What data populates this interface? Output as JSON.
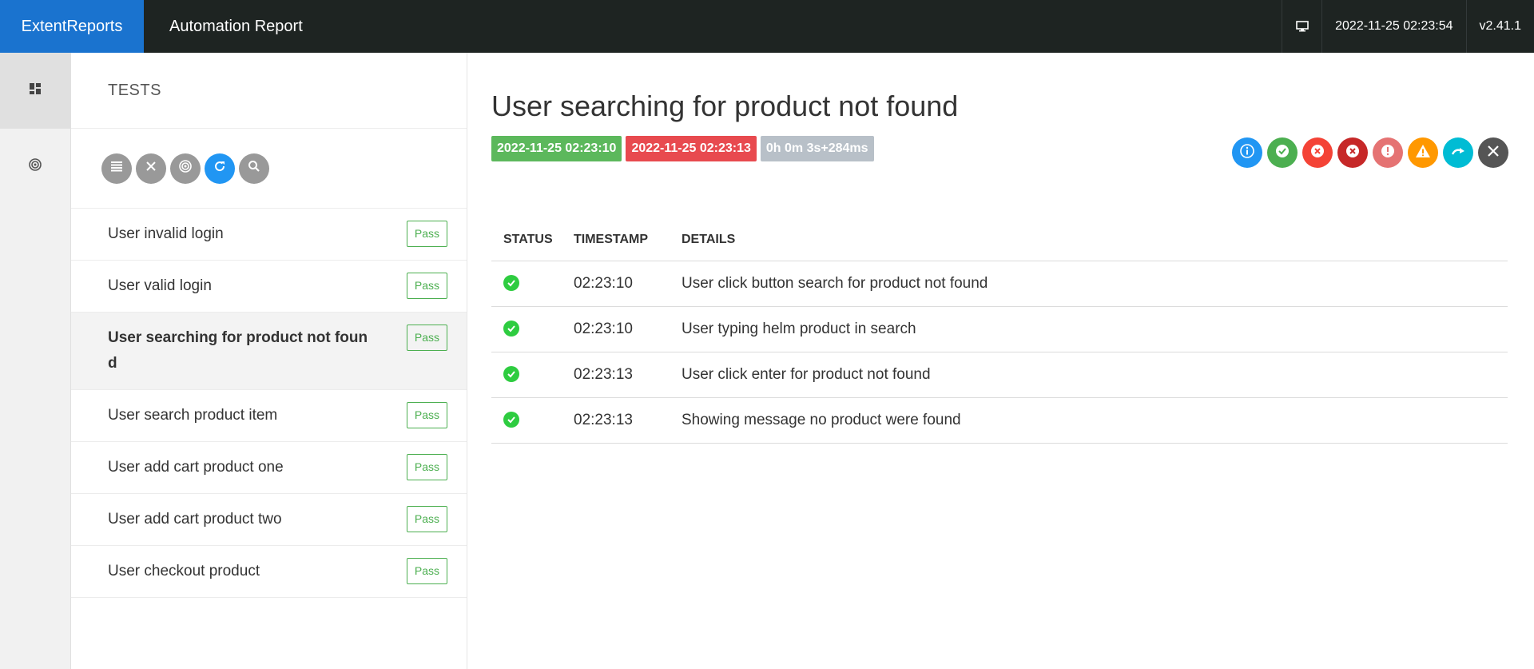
{
  "header": {
    "brand": "ExtentReports",
    "title": "Automation Report",
    "datetime": "2022-11-25 02:23:54",
    "version": "v2.41.1"
  },
  "leftnav": {
    "items": [
      {
        "icon": "dashboard-icon",
        "active": true
      },
      {
        "icon": "radar-icon",
        "active": false
      }
    ]
  },
  "tests_panel": {
    "title": "TESTS",
    "tools": [
      "list-icon",
      "close-icon",
      "radar-icon",
      "refresh-icon",
      "search-icon"
    ],
    "items": [
      {
        "name": "User invalid login",
        "status": "Pass"
      },
      {
        "name": "User valid login",
        "status": "Pass"
      },
      {
        "name": "User searching for product not found",
        "status": "Pass",
        "active": true
      },
      {
        "name": "User search product item",
        "status": "Pass"
      },
      {
        "name": "User add cart product one",
        "status": "Pass"
      },
      {
        "name": "User add cart product two",
        "status": "Pass"
      },
      {
        "name": "User checkout product",
        "status": "Pass"
      }
    ]
  },
  "detail": {
    "title": "User searching for product not found",
    "start_time": "2022-11-25 02:23:10",
    "end_time": "2022-11-25 02:23:13",
    "duration": "0h 0m 3s+284ms",
    "filters": [
      {
        "icon": "info-icon",
        "color": "#2196f3"
      },
      {
        "icon": "pass-icon",
        "color": "#4caf50"
      },
      {
        "icon": "fail-icon",
        "color": "#f44336"
      },
      {
        "icon": "fatal-icon",
        "color": "#c62828"
      },
      {
        "icon": "error-icon",
        "color": "#e57373"
      },
      {
        "icon": "warning-icon",
        "color": "#ff9800"
      },
      {
        "icon": "skip-icon",
        "color": "#00bcd4"
      },
      {
        "icon": "clear-icon",
        "color": "#555555"
      }
    ],
    "table": {
      "headers": [
        "STATUS",
        "TIMESTAMP",
        "DETAILS"
      ],
      "rows": [
        {
          "status": "pass",
          "time": "02:23:10",
          "details": "User click button search for product not found"
        },
        {
          "status": "pass",
          "time": "02:23:10",
          "details": "User typing helm product in search"
        },
        {
          "status": "pass",
          "time": "02:23:13",
          "details": "User click enter for product not found"
        },
        {
          "status": "pass",
          "time": "02:23:13",
          "details": "Showing message no product were found"
        }
      ]
    }
  }
}
